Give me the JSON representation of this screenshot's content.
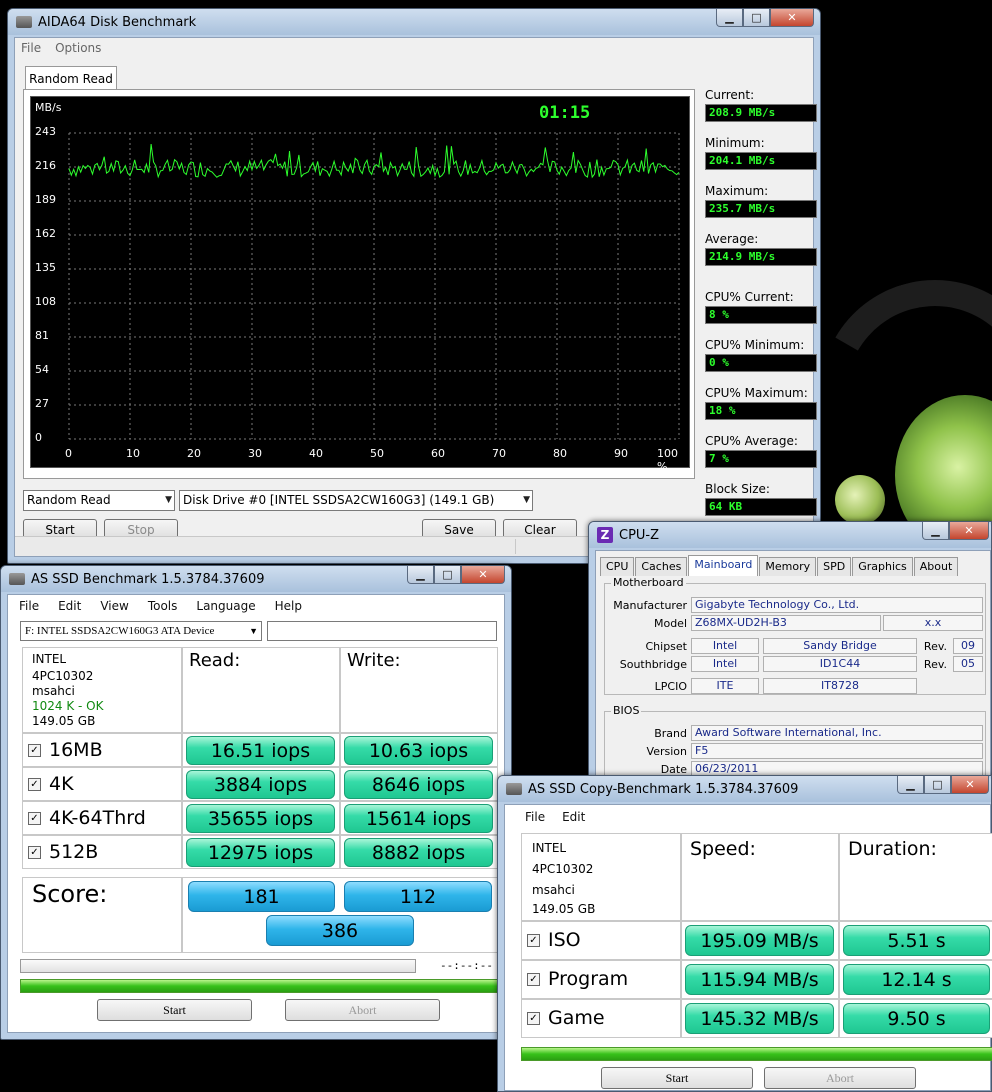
{
  "aida": {
    "title": "AIDA64 Disk Benchmark",
    "menu": [
      "File",
      "Options"
    ],
    "tab": "Random Read",
    "graph": {
      "unit": "MB/s",
      "timer": "01:15",
      "y_ticks": [
        "243",
        "216",
        "189",
        "162",
        "135",
        "108",
        "81",
        "54",
        "27",
        "0"
      ],
      "x_ticks": [
        "0",
        "10",
        "20",
        "30",
        "40",
        "50",
        "60",
        "70",
        "80",
        "90",
        "100 %"
      ],
      "ylim": [
        0,
        270
      ],
      "line_color": "#2dff2d"
    },
    "stats": {
      "current_label": "Current:",
      "current": "208.9 MB/s",
      "minimum_label": "Minimum:",
      "minimum": "204.1 MB/s",
      "maximum_label": "Maximum:",
      "maximum": "235.7 MB/s",
      "average_label": "Average:",
      "average": "214.9 MB/s",
      "cpu_current_label": "CPU% Current:",
      "cpu_current": "8 %",
      "cpu_minimum_label": "CPU% Minimum:",
      "cpu_minimum": "0 %",
      "cpu_maximum_label": "CPU% Maximum:",
      "cpu_maximum": "18 %",
      "cpu_average_label": "CPU% Average:",
      "cpu_average": "7 %",
      "block_size_label": "Block Size:",
      "block_size": "64 KB"
    },
    "test_select": "Random Read",
    "drive_select": "Disk Drive #0  [INTEL SSDSA2CW160G3]  (149.1 GB)",
    "buttons": {
      "start": "Start",
      "stop": "Stop",
      "save": "Save",
      "clear": "Clear"
    }
  },
  "asssd": {
    "title": "AS SSD Benchmark 1.5.3784.37609",
    "menu": [
      "File",
      "Edit",
      "View",
      "Tools",
      "Language",
      "Help"
    ],
    "device": "F: INTEL SSDSA2CW160G3 ATA Device",
    "info": [
      "INTEL",
      "4PC10302",
      "msahci",
      "1024 K - OK",
      "149.05 GB"
    ],
    "read_header": "Read:",
    "write_header": "Write:",
    "rows": [
      {
        "label": "16MB",
        "read": "16.51 iops",
        "write": "10.63 iops"
      },
      {
        "label": "4K",
        "read": "3884 iops",
        "write": "8646 iops"
      },
      {
        "label": "4K-64Thrd",
        "read": "35655 iops",
        "write": "15614 iops"
      },
      {
        "label": "512B",
        "read": "12975 iops",
        "write": "8882 iops"
      }
    ],
    "score_label": "Score:",
    "score_read": "181",
    "score_write": "112",
    "score_total": "386",
    "time": "--:--:--",
    "start": "Start",
    "abort": "Abort"
  },
  "cpuz": {
    "title": "CPU-Z",
    "tabs": [
      "CPU",
      "Caches",
      "Mainboard",
      "Memory",
      "SPD",
      "Graphics",
      "About"
    ],
    "motherboard_title": "Motherboard",
    "manufacturer_label": "Manufacturer",
    "manufacturer": "Gigabyte Technology Co., Ltd.",
    "model_label": "Model",
    "model": "Z68MX-UD2H-B3",
    "model_rev": "x.x",
    "chipset_label": "Chipset",
    "chipset_vendor": "Intel",
    "chipset_name": "Sandy Bridge",
    "chipset_rev_label": "Rev.",
    "chipset_rev": "09",
    "southbridge_label": "Southbridge",
    "sb_vendor": "Intel",
    "sb_name": "ID1C44",
    "sb_rev_label": "Rev.",
    "sb_rev": "05",
    "lpcio_label": "LPCIO",
    "lpcio_vendor": "ITE",
    "lpcio_name": "IT8728",
    "bios_title": "BIOS",
    "brand_label": "Brand",
    "brand": "Award Software International, Inc.",
    "version_label": "Version",
    "version": "F5",
    "date_label": "Date",
    "date": "06/23/2011"
  },
  "ascopy": {
    "title": "AS SSD Copy-Benchmark 1.5.3784.37609",
    "menu": [
      "File",
      "Edit"
    ],
    "info": [
      "INTEL",
      "4PC10302",
      "msahci",
      "149.05 GB"
    ],
    "speed_header": "Speed:",
    "duration_header": "Duration:",
    "rows": [
      {
        "label": "ISO",
        "speed": "195.09 MB/s",
        "duration": "5.51 s"
      },
      {
        "label": "Program",
        "speed": "115.94 MB/s",
        "duration": "12.14 s"
      },
      {
        "label": "Game",
        "speed": "145.32 MB/s",
        "duration": "9.50 s"
      }
    ],
    "start": "Start",
    "abort": "Abort"
  }
}
